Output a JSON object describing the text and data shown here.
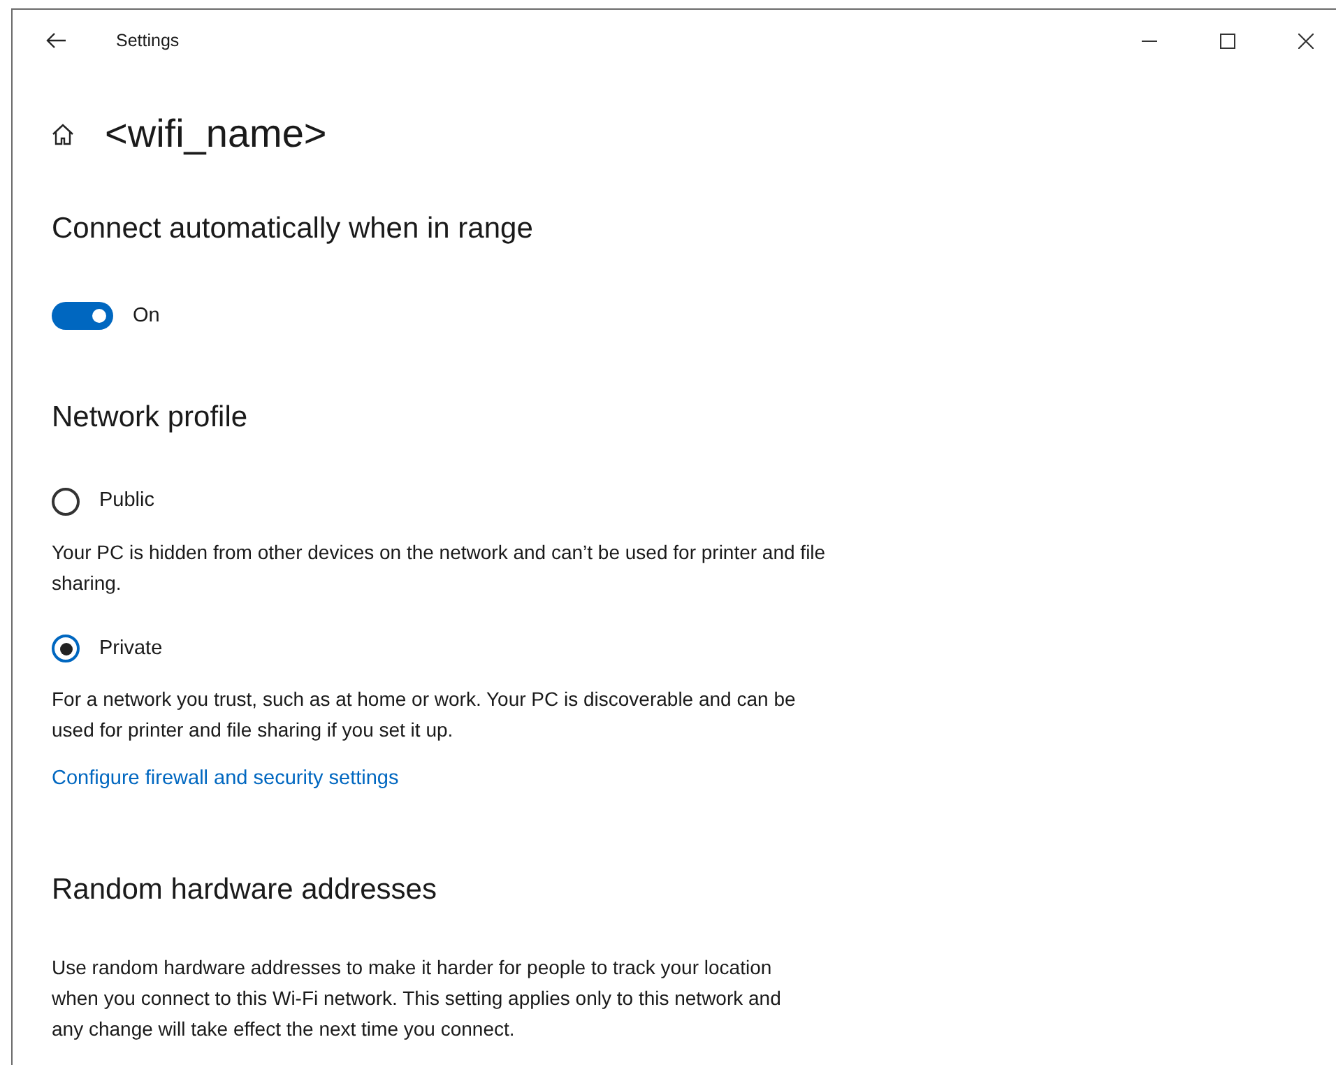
{
  "window": {
    "title": "Settings"
  },
  "page_title": "<wifi_name>",
  "auto_connect": {
    "heading": "Connect automatically when in range",
    "on": true,
    "label": "On"
  },
  "network_profile": {
    "heading": "Network profile",
    "options": [
      {
        "label": "Public",
        "selected": false,
        "description": "Your PC is hidden from other devices on the network and can’t be used for printer and file sharing."
      },
      {
        "label": "Private",
        "selected": true,
        "description": "For a network you trust, such as at home or work. Your PC is discoverable and can be used for printer and file sharing if you set it up."
      }
    ],
    "link": "Configure firewall and security settings"
  },
  "random_hardware": {
    "heading": "Random hardware addresses",
    "description": "Use random hardware addresses to make it harder for people to track your location when you connect to this Wi-Fi network. This setting applies only to this network and any change will take effect the next time you connect."
  }
}
